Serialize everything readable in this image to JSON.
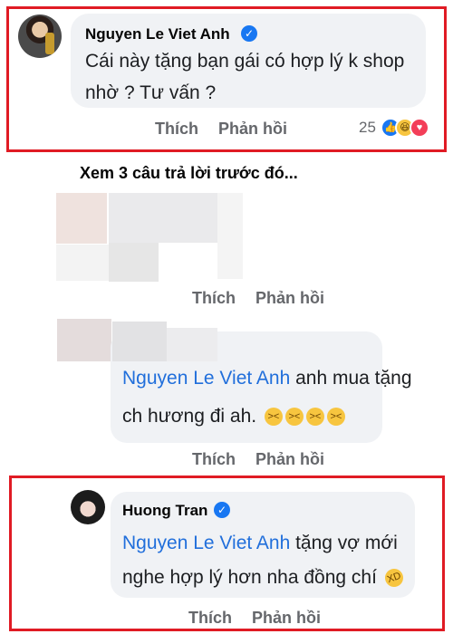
{
  "comment_top": {
    "author": "Nguyen Le Viet Anh",
    "line1": "Cái này tặng bạn gái có hợp lý k shop",
    "line2": "nhờ ? Tư vấn ?",
    "like_label": "Thích",
    "reply_label": "Phản hồi",
    "reaction_count": "25",
    "reactions": [
      "like-icon",
      "haha-icon",
      "love-icon"
    ]
  },
  "view_previous": "Xem 3 câu trả lời trước đó...",
  "reply_blurred": {
    "like_label": "Thích",
    "reply_label": "Phản hồi"
  },
  "reply_mention": {
    "mention": "Nguyen Le Viet Anh",
    "text1": " anh mua tặng",
    "line2": "ch hương đi ah.",
    "emoji": "grinning-squinting-face",
    "like_label": "Thích",
    "reply_label": "Phản hồi"
  },
  "reply_huong": {
    "author": "Huong Tran",
    "mention": "Nguyen Le Viet Anh",
    "text1": " tặng vợ mới",
    "line2": "nghe hợp lý hơn nha đồng chí",
    "emoji": "rolling-on-floor-laughing",
    "like_label": "Thích",
    "reply_label": "Phản hồi"
  },
  "colors": {
    "highlight": "#e01b24",
    "mention": "#216fdb",
    "bubble": "#f0f2f5",
    "verified": "#1877f2"
  }
}
